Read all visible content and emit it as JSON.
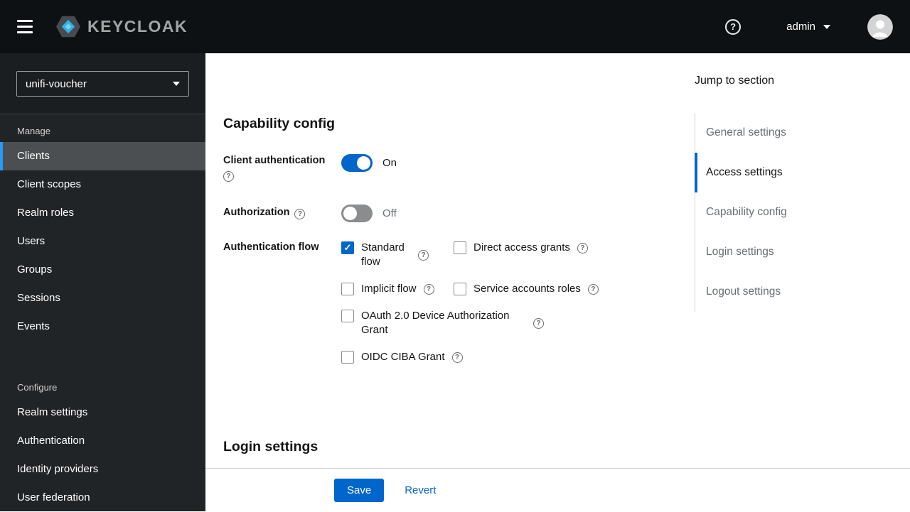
{
  "icons": {
    "help": "?",
    "check": "✓"
  },
  "colors": {
    "accent": "#0066cc",
    "toggle_off": "#8a8d90",
    "sidebar_bg": "#212427",
    "header_bg": "#0e1113",
    "active_nav_indicator": "#2b9af3"
  },
  "header": {
    "brand": "KEYCLOAK",
    "user": "admin"
  },
  "sidebar": {
    "realm": "unifi-voucher",
    "sections": [
      {
        "label": "Manage",
        "items": [
          {
            "label": "Clients",
            "active": true
          },
          {
            "label": "Client scopes",
            "active": false
          },
          {
            "label": "Realm roles",
            "active": false
          },
          {
            "label": "Users",
            "active": false
          },
          {
            "label": "Groups",
            "active": false
          },
          {
            "label": "Sessions",
            "active": false
          },
          {
            "label": "Events",
            "active": false
          }
        ]
      },
      {
        "label": "Configure",
        "items": [
          {
            "label": "Realm settings",
            "active": false
          },
          {
            "label": "Authentication",
            "active": false
          },
          {
            "label": "Identity providers",
            "active": false
          },
          {
            "label": "User federation",
            "active": false
          }
        ]
      }
    ]
  },
  "main": {
    "capability_heading": "Capability config",
    "login_heading": "Login settings",
    "client_auth": {
      "label": "Client authentication",
      "state": "On",
      "enabled": true
    },
    "authorization": {
      "label": "Authorization",
      "state": "Off",
      "enabled": false
    },
    "auth_flow": {
      "label": "Authentication flow",
      "options": [
        {
          "label": "Standard flow",
          "checked": true
        },
        {
          "label": "Direct access grants",
          "checked": false
        },
        {
          "label": "Implicit flow",
          "checked": false
        },
        {
          "label": "Service accounts roles",
          "checked": false
        },
        {
          "label": "OAuth 2.0 Device Authorization Grant",
          "checked": false
        },
        {
          "label": "OIDC CIBA Grant",
          "checked": false
        }
      ]
    },
    "actions": {
      "save": "Save",
      "revert": "Revert"
    }
  },
  "jump_nav": {
    "title": "Jump to section",
    "items": [
      {
        "label": "General settings",
        "active": false
      },
      {
        "label": "Access settings",
        "active": true
      },
      {
        "label": "Capability config",
        "active": false
      },
      {
        "label": "Login settings",
        "active": false
      },
      {
        "label": "Logout settings",
        "active": false
      }
    ]
  }
}
